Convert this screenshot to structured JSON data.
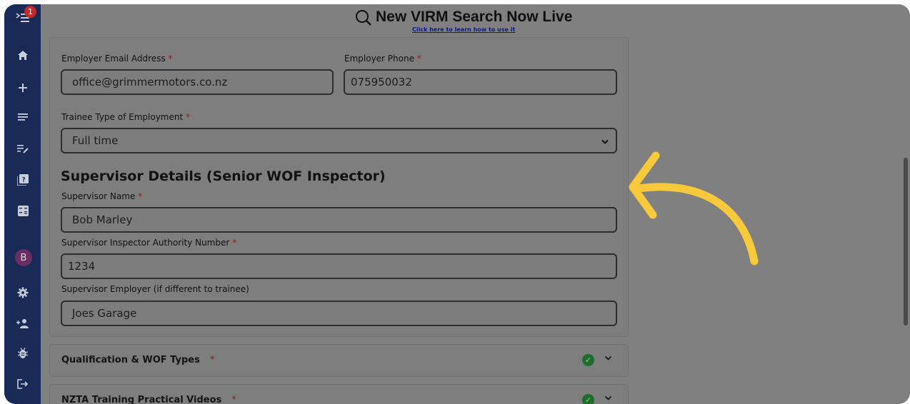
{
  "banner": {
    "title": "New VIRM Search Now Live",
    "link": "Click here to learn how to use it"
  },
  "sidebar": {
    "notification_count": "1",
    "avatar_letter": "B",
    "icons": [
      "menu-icon",
      "home-icon",
      "plus-icon",
      "list-icon",
      "edit-list-icon",
      "quiz-icon",
      "calculator-icon",
      "settings-icon",
      "add-user-icon",
      "bug-icon",
      "logout-icon"
    ]
  },
  "form": {
    "employer_email_label": "Employer Email Address",
    "employer_email_value": "office@grimmermotors.co.nz",
    "employer_phone_label": "Employer Phone",
    "employer_phone_value": "075950032",
    "employment_type_label": "Trainee Type of Employment",
    "employment_type_value": "Full time",
    "supervisor_section_title": "Supervisor Details (Senior WOF Inspector)",
    "supervisor_name_label": "Supervisor Name",
    "supervisor_name_value": "Bob Marley",
    "supervisor_authority_label": "Supervisor Inspector Authority Number",
    "supervisor_authority_value": "1234",
    "supervisor_employer_label": "Supervisor Employer (if different to trainee)",
    "supervisor_employer_value": "Joes Garage",
    "required_marker": "*"
  },
  "accordions": [
    {
      "title": "Qualification & WOF Types",
      "status": "complete"
    },
    {
      "title": "NZTA Training Practical Videos",
      "status": "complete"
    }
  ],
  "colors": {
    "overlay": "#808080",
    "sidebar": "#1a2a56",
    "arrow": "#f7c93b",
    "check": "#1f6d2a"
  }
}
